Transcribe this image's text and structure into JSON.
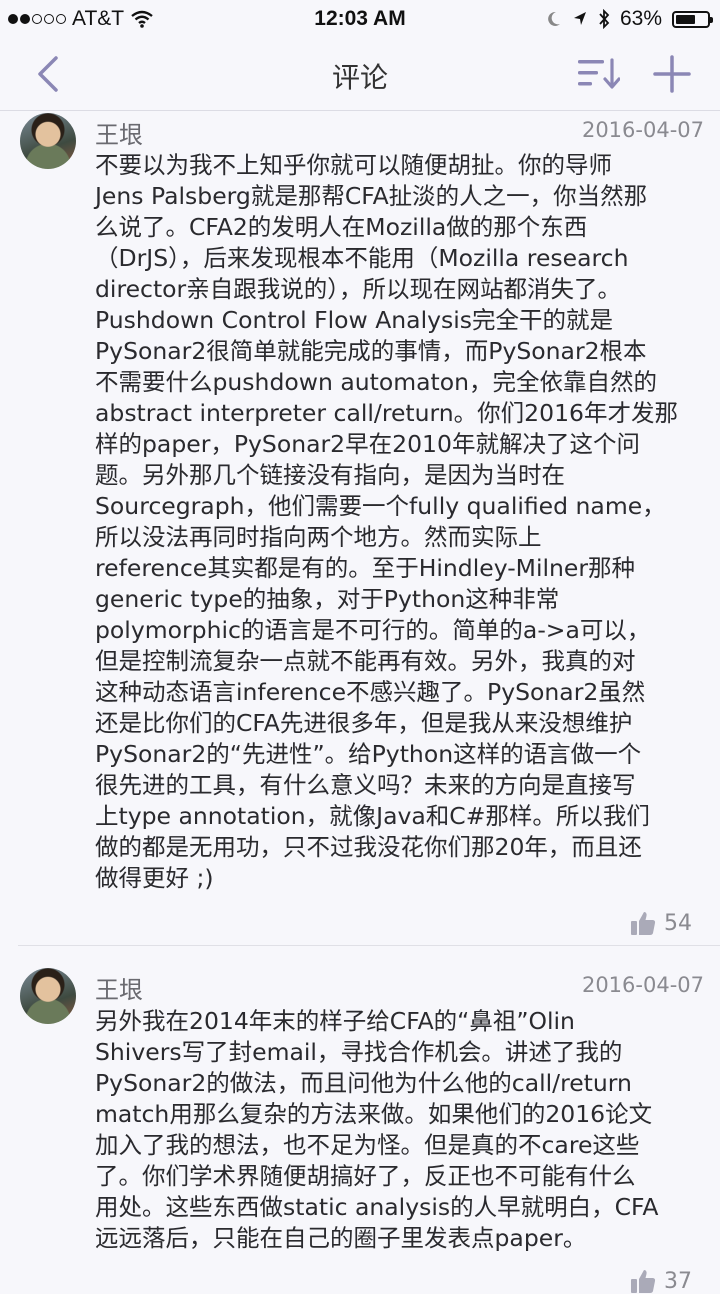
{
  "status": {
    "carrier": "AT&T",
    "time": "12:03 AM",
    "battery": "63%",
    "battery_level": 0.63
  },
  "nav": {
    "title": "评论",
    "icons": [
      "back-chevron-icon",
      "sort-icon",
      "add-icon"
    ]
  },
  "comments": [
    {
      "author": "王垠",
      "date": "2016-04-07",
      "text": "不要以为我不上知乎你就可以随便胡扯。你的导师\nJens Palsberg就是那帮CFA扯淡的人之一，你当然那\n么说了。CFA2的发明人在Mozilla做的那个东西\n（DrJS），后来发现根本不能用（Mozilla research\ndirector亲自跟我说的），所以现在网站都消失了。\nPushdown Control Flow Analysis完全干的就是\nPySonar2很简单就能完成的事情，而PySonar2根本\n不需要什么pushdown automaton，完全依靠自然的\nabstract interpreter call/return。你们2016年才发那\n样的paper，PySonar2早在2010年就解决了这个问\n题。另外那几个链接没有指向，是因为当时在\nSourcegraph，他们需要一个fully qualified name，\n所以没法再同时指向两个地方。然而实际上\nreference其实都是有的。至于Hindley-Milner那种\ngeneric type的抽象，对于Python这种非常\npolymorphic的语言是不可行的。简单的a->a可以，\n但是控制流复杂一点就不能再有效。另外，我真的对\n这种动态语言inference不感兴趣了。PySonar2虽然\n还是比你们的CFA先进很多年，但是我从来没想维护\nPySonar2的“先进性”。给Python这样的语言做一个\n很先进的工具，有什么意义吗？未来的方向是直接写\n上type annotation，就像Java和C#那样。所以我们\n做的都是无用功，只不过我没花你们那20年，而且还\n做得更好 ;)",
      "likes": "54"
    },
    {
      "author": "王垠",
      "date": "2016-04-07",
      "text": "另外我在2014年末的样子给CFA的“鼻祖”Olin\nShivers写了封email，寻找合作机会。讲述了我的\nPySonar2的做法，而且问他为什么他的call/return\nmatch用那么复杂的方法来做。如果他们的2016论文\n加入了我的想法，也不足为怪。但是真的不care这些\n了。你们学术界随便胡搞好了，反正也不可能有什么\n用处。这些东西做static analysis的人早就明白，CFA\n远远落后，只能在自己的圈子里发表点paper。",
      "likes": "37"
    }
  ]
}
